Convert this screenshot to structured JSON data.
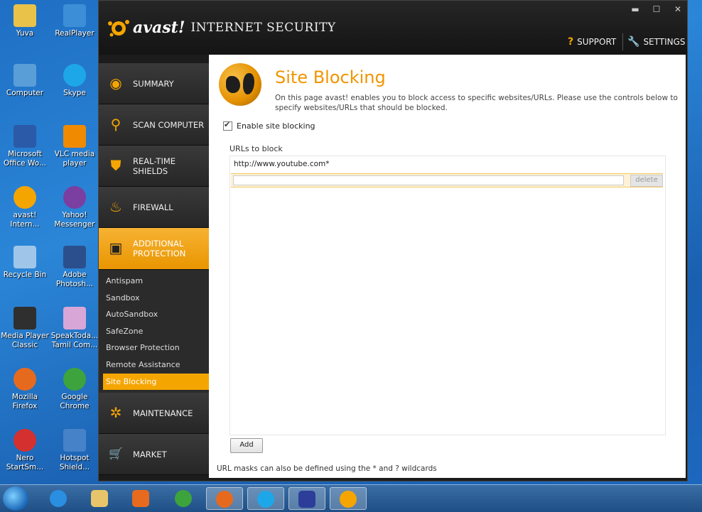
{
  "desktop": {
    "icons": [
      {
        "label": "Yuva",
        "color": "#e9c24a"
      },
      {
        "label": "RealPlayer",
        "color": "#3c8fd6"
      },
      {
        "label": "Computer",
        "color": "#5a9ed8"
      },
      {
        "label": "Skype",
        "color": "#1ea7e8"
      },
      {
        "label": "Microsoft Office Wo...",
        "color": "#2a5aa8"
      },
      {
        "label": "VLC media player",
        "color": "#f08a00"
      },
      {
        "label": "avast! Intern...",
        "color": "#f5a500"
      },
      {
        "label": "Yahoo! Messenger",
        "color": "#7a3fa0"
      },
      {
        "label": "Recycle Bin",
        "color": "#9fc6e8"
      },
      {
        "label": "Adobe Photosh...",
        "color": "#2b4f8c"
      },
      {
        "label": "Media Player Classic",
        "color": "#2f2f2f"
      },
      {
        "label": "SpeakToda... Tamil Com...",
        "color": "#d8a7d8"
      },
      {
        "label": "Mozilla Firefox",
        "color": "#e66a1e"
      },
      {
        "label": "Google Chrome",
        "color": "#3da33d"
      },
      {
        "label": "Nero StartSm...",
        "color": "#d43030"
      },
      {
        "label": "Hotspot Shield...",
        "color": "#4682c8"
      }
    ]
  },
  "window": {
    "brand": "avast!",
    "product": "INTERNET SECURITY",
    "controls": {
      "minimize": "▬",
      "maximize": "☐",
      "close": "✕"
    },
    "support_label": "SUPPORT",
    "settings_label": "SETTINGS"
  },
  "nav": {
    "items": [
      {
        "label": "SUMMARY",
        "icon": "eye-icon",
        "glyph": "◉"
      },
      {
        "label": "SCAN COMPUTER",
        "icon": "magnifier-icon",
        "glyph": "⚲"
      },
      {
        "label": "REAL-TIME\nSHIELDS",
        "icon": "shield-icon",
        "glyph": "⛊"
      },
      {
        "label": "FIREWALL",
        "icon": "flame-icon",
        "glyph": "♨"
      },
      {
        "label": "ADDITIONAL\nPROTECTION",
        "icon": "box-icon",
        "glyph": "▣"
      }
    ],
    "sub_items": [
      "Antispam",
      "Sandbox",
      "AutoSandbox",
      "SafeZone",
      "Browser Protection",
      "Remote Assistance",
      "Site Blocking"
    ],
    "bottom_items": [
      {
        "label": "MAINTENANCE",
        "icon": "cog-icon",
        "glyph": "✲"
      },
      {
        "label": "MARKET",
        "icon": "cart-icon",
        "glyph": "🛒"
      }
    ]
  },
  "content": {
    "title": "Site Blocking",
    "description": "On this page avast! enables you to block access to specific websites/URLs. Please use the controls below to specify websites/URLs that should be blocked.",
    "enable_label": "Enable site blocking",
    "urls_label": "URLs to block",
    "urls": [
      "http://www.youtube.com*"
    ],
    "new_url_value": "",
    "delete_label": "delete",
    "add_label": "Add",
    "footer_note": "URL masks can also be defined using the * and ? wildcards"
  },
  "taskbar": {
    "buttons": [
      {
        "name": "ie",
        "color": "#2a8fe0"
      },
      {
        "name": "explorer",
        "color": "#e8c56a"
      },
      {
        "name": "media",
        "color": "#e86a1e"
      },
      {
        "name": "chrome",
        "color": "#3da33d"
      },
      {
        "name": "firefox",
        "color": "#e66a1e"
      },
      {
        "name": "skype",
        "color": "#1ea7e8"
      },
      {
        "name": "app",
        "color": "#2c3e9a"
      },
      {
        "name": "avast",
        "color": "#f5a500"
      }
    ]
  }
}
